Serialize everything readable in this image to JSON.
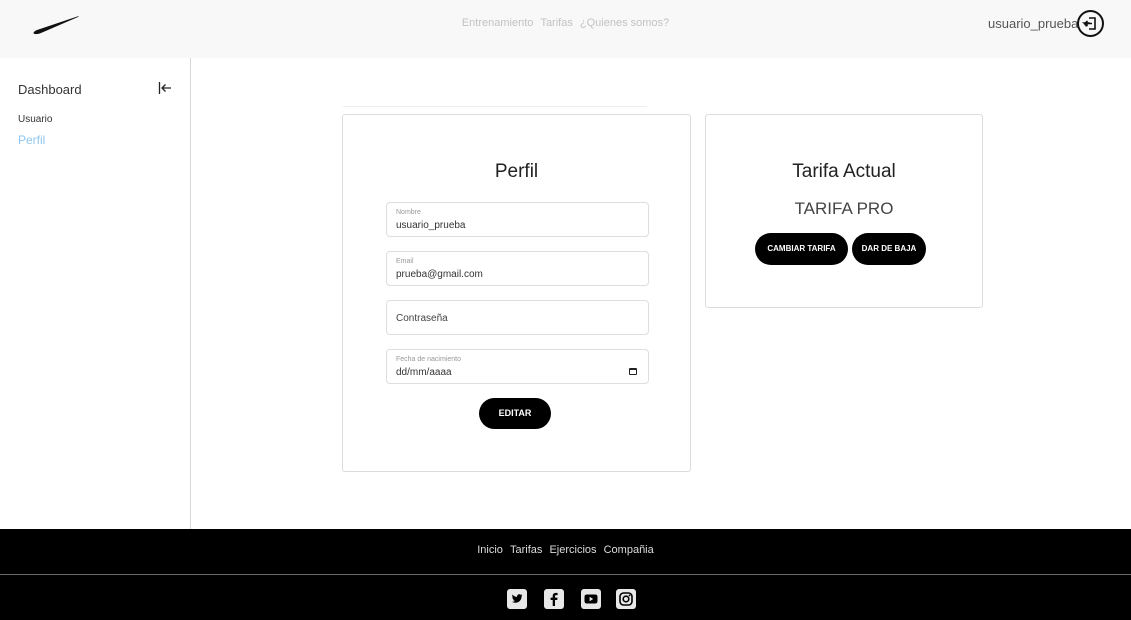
{
  "header": {
    "nav": [
      "Entrenamiento",
      "Tarifas",
      "¿Quienes somos?"
    ],
    "username": "usuario_prueba"
  },
  "sidebar": {
    "title": "Dashboard",
    "section": "Usuario",
    "items": [
      {
        "label": "Perfil"
      }
    ]
  },
  "profile": {
    "title": "Perfil",
    "fields": {
      "name": {
        "label": "Nombre",
        "value": "usuario_prueba"
      },
      "email": {
        "label": "Email",
        "value": "prueba@gmail.com"
      },
      "password": {
        "placeholder": "Contraseña"
      },
      "birthdate": {
        "label": "Fecha de nacimiento",
        "value": "dd/mm/aaaa"
      }
    },
    "edit_label": "EDITAR"
  },
  "plan": {
    "title": "Tarifa Actual",
    "name": "TARIFA PRO",
    "change_label": "CAMBIAR TARIFA",
    "cancel_label": "DAR DE BAJA"
  },
  "footer": {
    "links": [
      "Inicio",
      "Tarifas",
      "Ejercicios",
      "Compañia"
    ],
    "social": [
      "twitter-icon",
      "facebook-icon",
      "youtube-icon",
      "instagram-icon"
    ]
  },
  "colors": {
    "accent_link": "#8ec6ee",
    "button": "#000000",
    "footer_bg": "#000000",
    "topbar_bg": "#f8f8f8"
  }
}
